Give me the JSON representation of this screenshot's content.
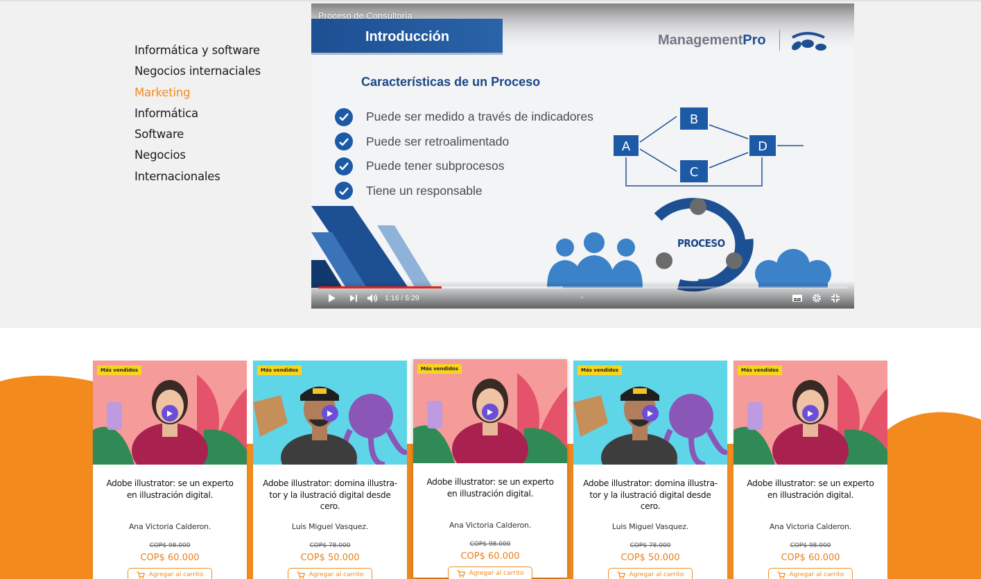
{
  "categories": {
    "items": [
      {
        "label": "Informática y software",
        "active": false
      },
      {
        "label": "Negocios internaciales",
        "active": false
      },
      {
        "label": "Marketing",
        "active": true
      },
      {
        "label": "Informática",
        "active": false
      },
      {
        "label": "Software",
        "active": false
      },
      {
        "label": "Negocios",
        "active": false
      },
      {
        "label": "Internacionales",
        "active": false
      }
    ]
  },
  "video": {
    "title": "Proceso de Consultoría",
    "slide_header": "Introducción",
    "brand_left": "Management",
    "brand_right": "Pro",
    "subtitle": "Características de un Proceso",
    "bullets": [
      "Puede ser medido a través de indicadores",
      "Puede ser retroalimentado",
      "Puede tener subprocesos",
      "Tiene un responsable"
    ],
    "diagram_nodes": [
      "A",
      "B",
      "C",
      "D"
    ],
    "cycle_label": "PROCESO",
    "time": "1:16 / 5:29",
    "progress_played": 0.233,
    "progress_buffered": 0.23
  },
  "colors": {
    "accent": "#f28a1e",
    "badge": "#f7d51e",
    "slide_blue": "#1d4f93",
    "play_purple": "#6c4ed6"
  },
  "courses": [
    {
      "badge": "Más vendidos",
      "title": "Adobe illustrator: se un experto en illustración digital.",
      "author": "Ana Victoria Calderon.",
      "old_price": "COP$ 98.000",
      "price": "COP$ 60.000",
      "cart": "Agregar al carrito",
      "thumb": "pink"
    },
    {
      "badge": "Más vendidos",
      "title": "Adobe illustrator: domina illustra-tor y la ilustració digital desde cero.",
      "author": "Luis Miguel Vasquez.",
      "old_price": "COP$ 78.000",
      "price": "COP$ 50.000",
      "cart": "Agregar al carrito",
      "thumb": "cyan"
    },
    {
      "badge": "Más vendidos",
      "title": "Adobe illustrator: se un experto en illustración digital.",
      "author": "Ana Victoria Calderon.",
      "old_price": "COP$ 98.000",
      "price": "COP$ 60.000",
      "cart": "Agregar al carrito",
      "thumb": "pink"
    },
    {
      "badge": "Más vendidos",
      "title": "Adobe illustrator: domina illustra-tor y la ilustració digital desde cero.",
      "author": "Luis Miguel Vasquez.",
      "old_price": "COP$ 78.000",
      "price": "COP$ 50.000",
      "cart": "Agregar al carrito",
      "thumb": "cyan"
    },
    {
      "badge": "Más vendidos",
      "title": "Adobe illustrator: se un experto en illustración digital.",
      "author": "Ana Victoria Calderon.",
      "old_price": "COP$ 98.000",
      "price": "COP$ 60.000",
      "cart": "Agregar al carrito",
      "thumb": "pink"
    }
  ]
}
